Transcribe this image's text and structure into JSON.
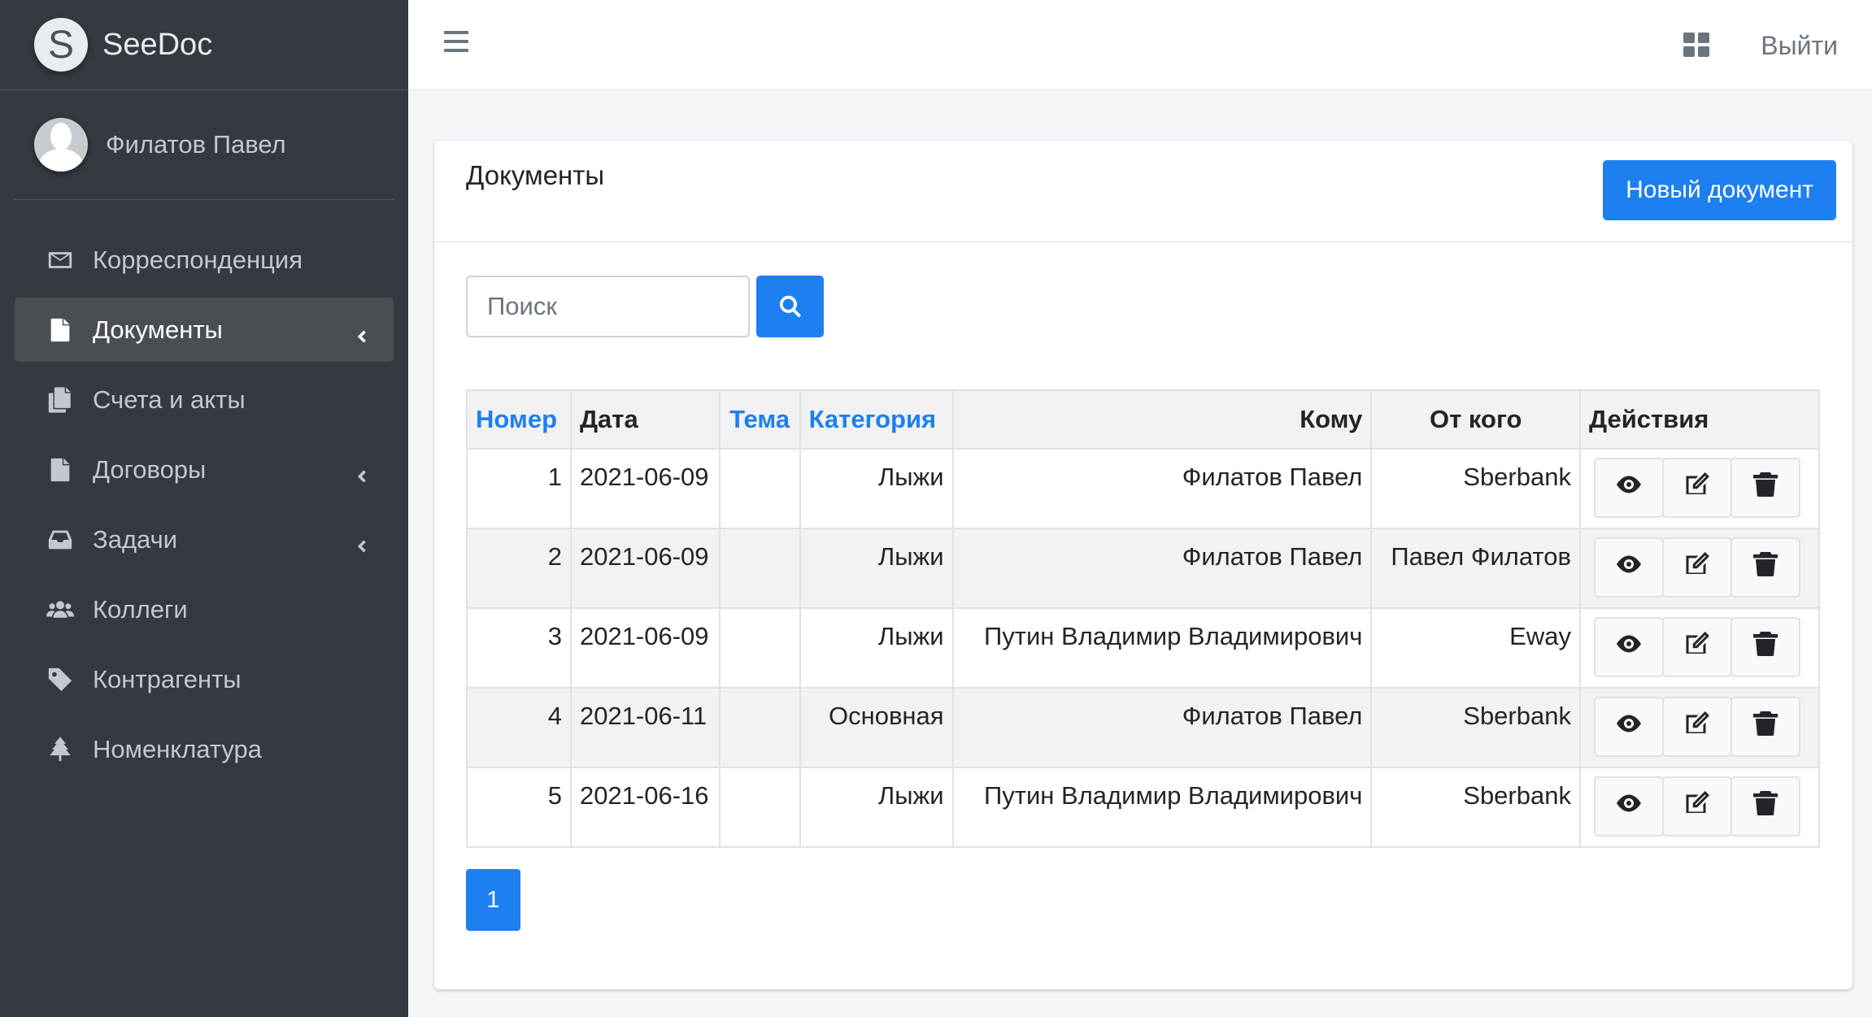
{
  "brand": {
    "logo_letter": "S",
    "name": "SeeDoc"
  },
  "user": {
    "name": "Филатов Павел"
  },
  "sidebar": {
    "items": [
      {
        "label": "Корреспонденция",
        "icon": "envelope-icon",
        "active": false,
        "has_arrow": false
      },
      {
        "label": "Документы",
        "icon": "file-icon",
        "active": true,
        "has_arrow": true
      },
      {
        "label": "Счета и акты",
        "icon": "copy-icon",
        "active": false,
        "has_arrow": false
      },
      {
        "label": "Договоры",
        "icon": "file-icon",
        "active": false,
        "has_arrow": true
      },
      {
        "label": "Задачи",
        "icon": "inbox-icon",
        "active": false,
        "has_arrow": true
      },
      {
        "label": "Коллеги",
        "icon": "users-icon",
        "active": false,
        "has_arrow": false
      },
      {
        "label": "Контрагенты",
        "icon": "tag-icon",
        "active": false,
        "has_arrow": false
      },
      {
        "label": "Номенклатура",
        "icon": "tree-icon",
        "active": false,
        "has_arrow": false
      }
    ]
  },
  "header": {
    "logout_label": "Выйти"
  },
  "card": {
    "title": "Документы",
    "new_button_label": "Новый документ",
    "search_placeholder": "Поиск"
  },
  "table": {
    "headers": [
      "Номер",
      "Дата",
      "Тема",
      "Категория",
      "Кому",
      "От кого",
      "Действия"
    ],
    "rows": [
      {
        "num": "1",
        "date": "2021-06-09",
        "topic": "",
        "category": "Лыжи",
        "to": "Филатов Павел",
        "from": "Sberbank"
      },
      {
        "num": "2",
        "date": "2021-06-09",
        "topic": "",
        "category": "Лыжи",
        "to": "Филатов Павел",
        "from": "Павел Филатов"
      },
      {
        "num": "3",
        "date": "2021-06-09",
        "topic": "",
        "category": "Лыжи",
        "to": "Путин Владимир Владимирович",
        "from": "Eway"
      },
      {
        "num": "4",
        "date": "2021-06-11",
        "topic": "",
        "category": "Основная",
        "to": "Филатов Павел",
        "from": "Sberbank"
      },
      {
        "num": "5",
        "date": "2021-06-16",
        "topic": "",
        "category": "Лыжи",
        "to": "Путин Владимир Владимирович",
        "from": "Sberbank"
      }
    ]
  },
  "pagination": {
    "current_page": "1"
  },
  "colors": {
    "primary": "#1d7ff0",
    "sidebar_bg": "#343a40",
    "sidebar_active": "#494e53"
  }
}
